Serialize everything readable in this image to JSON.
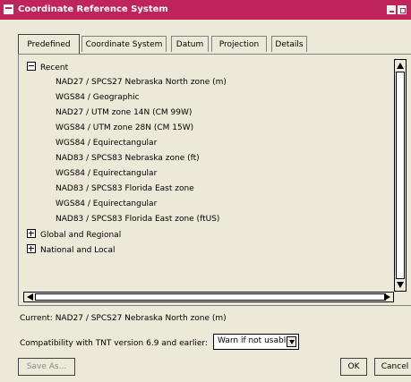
{
  "window": {
    "title": "Coordinate Reference System"
  },
  "tabs": [
    {
      "label": "Predefined",
      "active": true
    },
    {
      "label": "Coordinate System",
      "active": false
    },
    {
      "label": "Datum",
      "active": false
    },
    {
      "label": "Projection",
      "active": false
    },
    {
      "label": "Details",
      "active": false
    }
  ],
  "tree": {
    "recent": {
      "label": "Recent",
      "expanded": true,
      "items": [
        "NAD27 / SPCS27 Nebraska North zone (m)",
        "WGS84 / Geographic",
        "NAD27 / UTM zone 14N (CM 99W)",
        "WGS84 / UTM zone 28N (CM 15W)",
        "WGS84 / Equirectangular",
        "NAD83 / SPCS83 Nebraska zone (ft)",
        "WGS84 / Equirectangular",
        "NAD83 / SPCS83 Florida East zone",
        "WGS84 / Equirectangular",
        "NAD83 / SPCS83 Florida East zone (ftUS)"
      ]
    },
    "global": {
      "label": "Global and Regional",
      "expanded": false
    },
    "national": {
      "label": "National and Local",
      "expanded": false
    }
  },
  "current": "Current: NAD27 / SPCS27 Nebraska North zone (m)",
  "compat": {
    "label": "Compatibility with TNT version 6.9 and earlier:",
    "value": "Warn if not usable"
  },
  "buttons": {
    "save_as": "Save As...",
    "ok": "OK",
    "cancel": "Cancel"
  },
  "colors": {
    "titlebar": "#c0245c",
    "dialog_bg": "#ece9d8"
  }
}
